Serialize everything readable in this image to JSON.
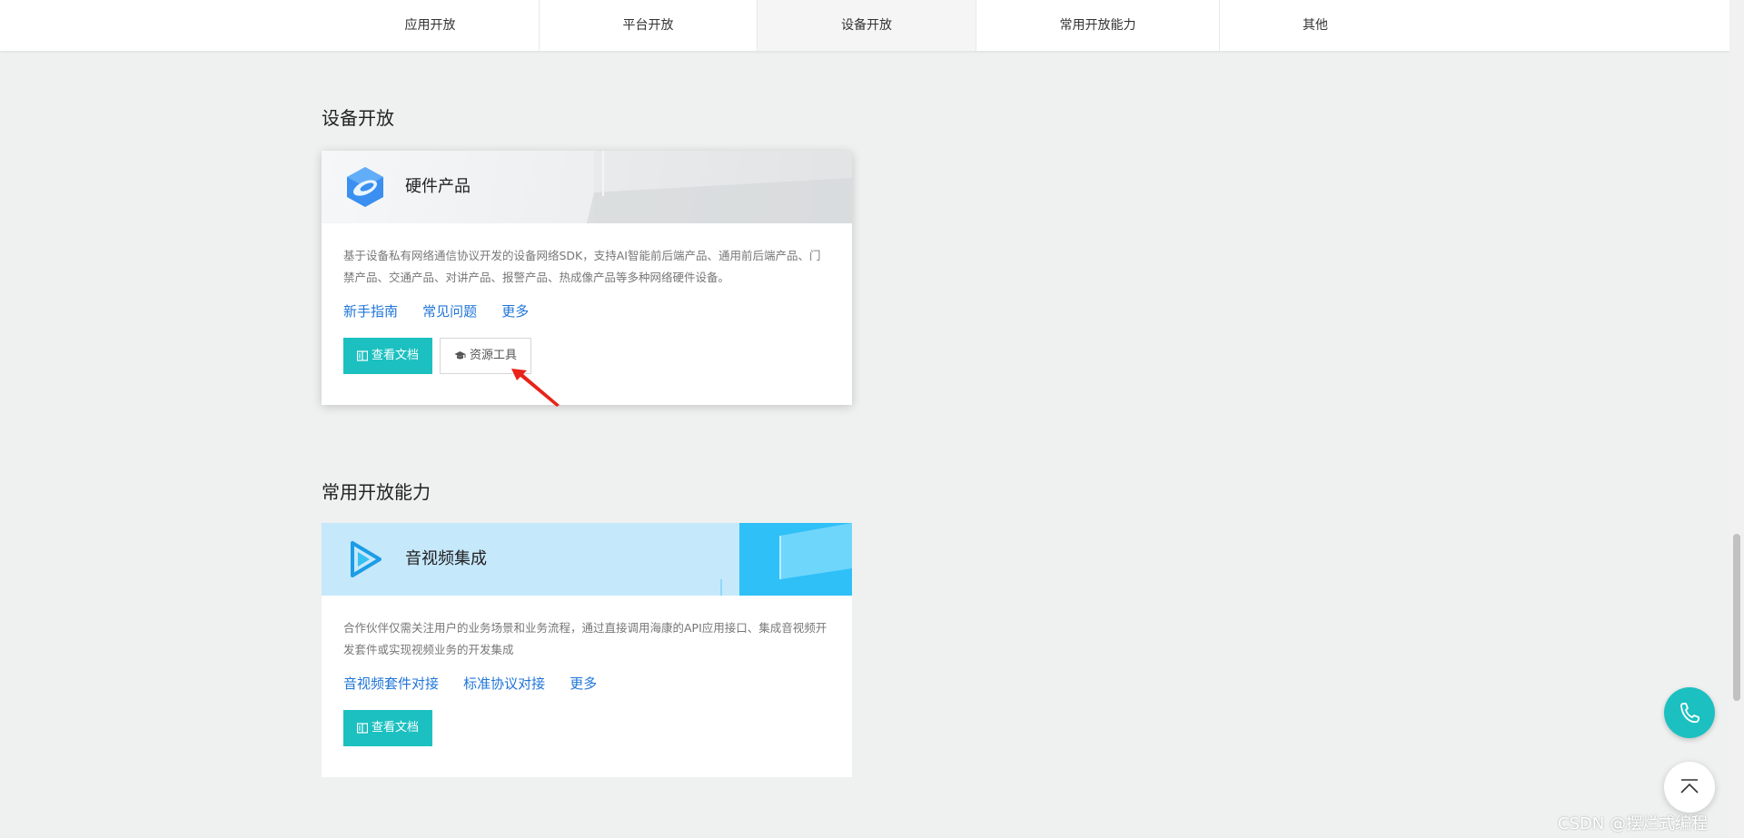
{
  "nav": {
    "tabs": [
      {
        "label": "应用开放"
      },
      {
        "label": "平台开放"
      },
      {
        "label": "设备开放"
      },
      {
        "label": "常用开放能力"
      },
      {
        "label": "其他"
      }
    ],
    "active_index": 2
  },
  "sections": [
    {
      "title": "设备开放",
      "card": {
        "icon": "hardware-product-icon",
        "title": "硬件产品",
        "description": "基于设备私有网络通信协议开发的设备网络SDK，支持AI智能前后端产品、通用前后端产品、门禁产品、交通产品、对讲产品、报警产品、热成像产品等多种网络硬件设备。",
        "links": [
          "新手指南",
          "常见问题",
          "更多"
        ],
        "primary_button": "查看文档",
        "secondary_button": "资源工具"
      }
    },
    {
      "title": "常用开放能力",
      "card": {
        "icon": "audio-video-icon",
        "title": "音视频集成",
        "description": "合作伙伴仅需关注用户的业务场景和业务流程，通过直接调用海康的API应用接口、集成音视频开发套件或实现视频业务的开发集成",
        "links": [
          "音视频套件对接",
          "标准协议对接",
          "更多"
        ],
        "primary_button": "查看文档"
      }
    }
  ],
  "float_buttons": {
    "phone": "phone-icon",
    "top": "back-to-top-icon"
  },
  "watermark": "CSDN @摆烂式编程",
  "colors": {
    "accent": "#1cc0c0",
    "link": "#1f75d8",
    "arrow": "#e8231a"
  }
}
